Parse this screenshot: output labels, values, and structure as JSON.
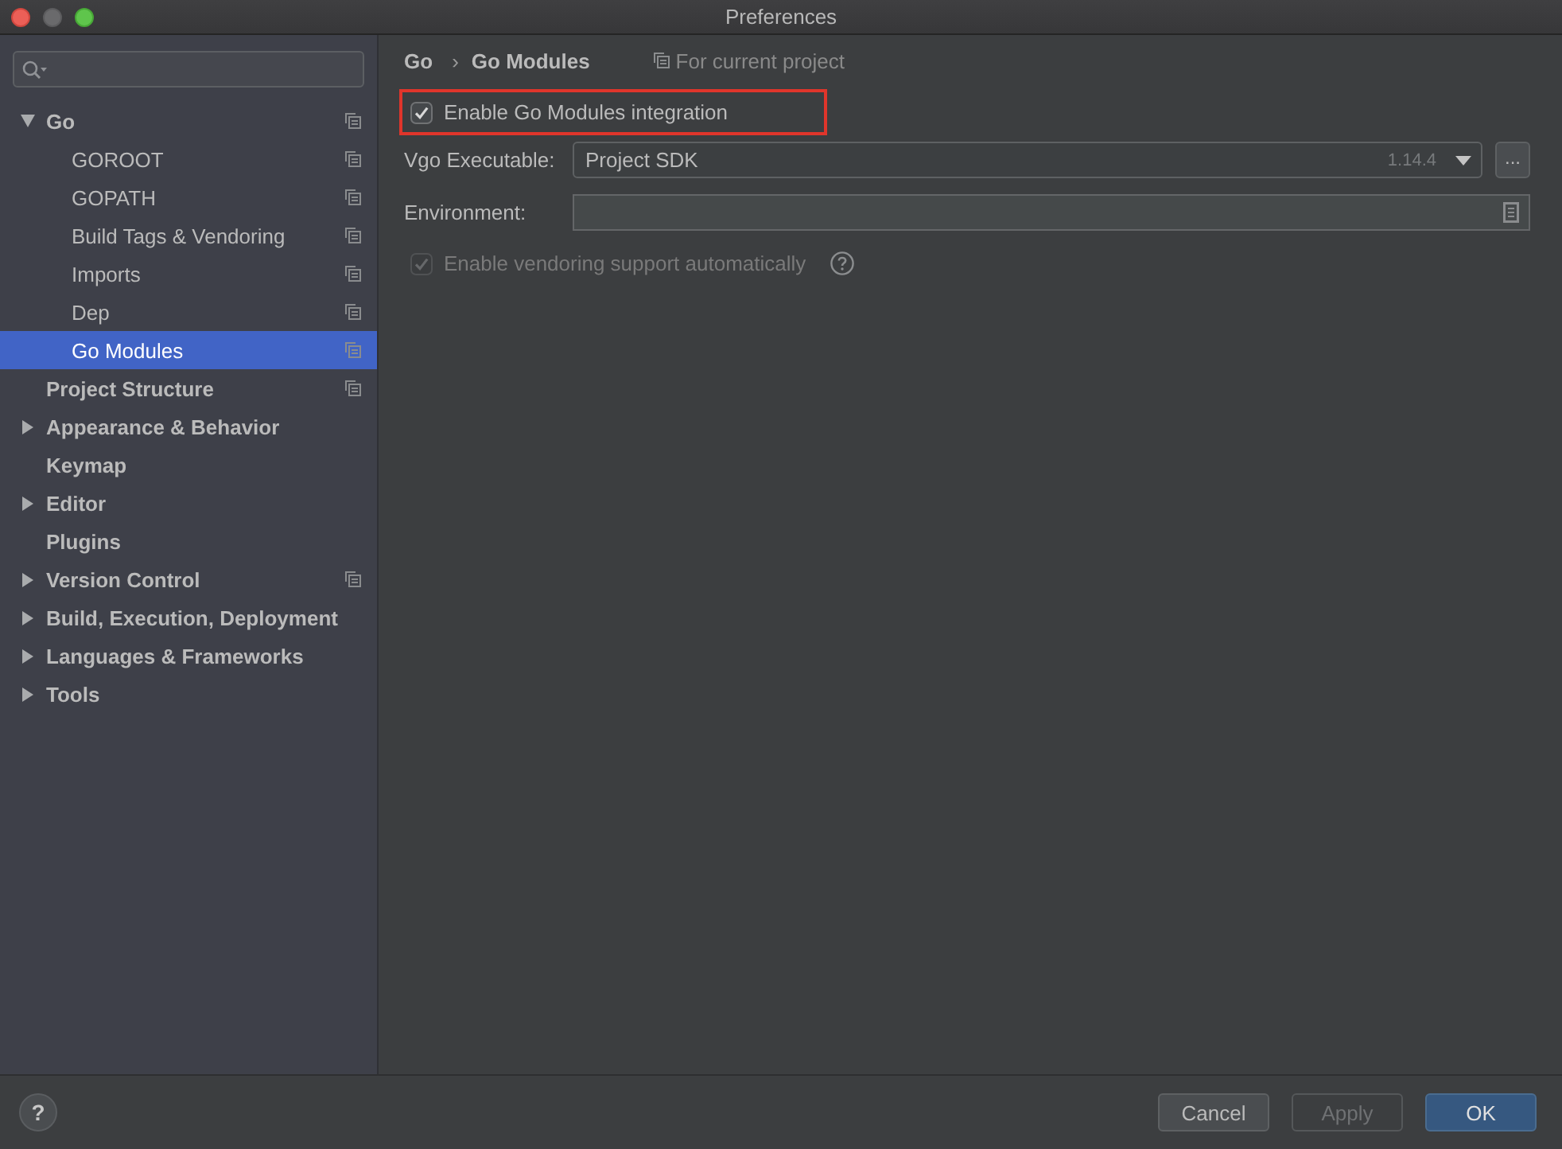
{
  "window": {
    "title": "Preferences"
  },
  "sidebar": {
    "items": [
      {
        "label": "Go",
        "expanded": true,
        "project_level": true,
        "selected": false,
        "children": [
          {
            "label": "GOROOT",
            "project_level": true,
            "selected": false
          },
          {
            "label": "GOPATH",
            "project_level": true,
            "selected": false
          },
          {
            "label": "Build Tags & Vendoring",
            "project_level": true,
            "selected": false
          },
          {
            "label": "Imports",
            "project_level": true,
            "selected": false
          },
          {
            "label": "Dep",
            "project_level": true,
            "selected": false
          },
          {
            "label": "Go Modules",
            "project_level": true,
            "selected": true
          }
        ]
      },
      {
        "label": "Project Structure",
        "project_level": true,
        "selected": false
      },
      {
        "label": "Appearance & Behavior",
        "expanded": false,
        "project_level": false,
        "selected": false
      },
      {
        "label": "Keymap",
        "project_level": false,
        "selected": false
      },
      {
        "label": "Editor",
        "expanded": false,
        "project_level": false,
        "selected": false
      },
      {
        "label": "Plugins",
        "project_level": false,
        "selected": false
      },
      {
        "label": "Version Control",
        "expanded": false,
        "project_level": true,
        "selected": false
      },
      {
        "label": "Build, Execution, Deployment",
        "expanded": false,
        "project_level": false,
        "selected": false
      },
      {
        "label": "Languages & Frameworks",
        "expanded": false,
        "project_level": false,
        "selected": false
      },
      {
        "label": "Tools",
        "expanded": false,
        "project_level": false,
        "selected": false
      }
    ]
  },
  "breadcrumb": {
    "items": [
      "Go",
      "Go Modules"
    ],
    "separator": "›",
    "scope": "For current project"
  },
  "settings": [
    {
      "kind": "checkbox",
      "label": "Enable Go Modules integration",
      "checked": true,
      "disabled": false,
      "highlighted": true,
      "help": false
    },
    {
      "kind": "combo",
      "label": "Vgo Executable:",
      "value": "Project SDK",
      "version": "1.14.4",
      "button": "..."
    },
    {
      "kind": "text",
      "label": "Environment:"
    },
    {
      "kind": "checkbox",
      "label": "Enable vendoring support automatically",
      "checked": true,
      "disabled": true,
      "highlighted": false,
      "help": true
    }
  ],
  "footer": {
    "help": "?",
    "buttons": [
      {
        "label": "Cancel",
        "disabled": false,
        "default": false
      },
      {
        "label": "Apply",
        "disabled": true,
        "default": false
      },
      {
        "label": "OK",
        "disabled": false,
        "default": true
      }
    ]
  }
}
